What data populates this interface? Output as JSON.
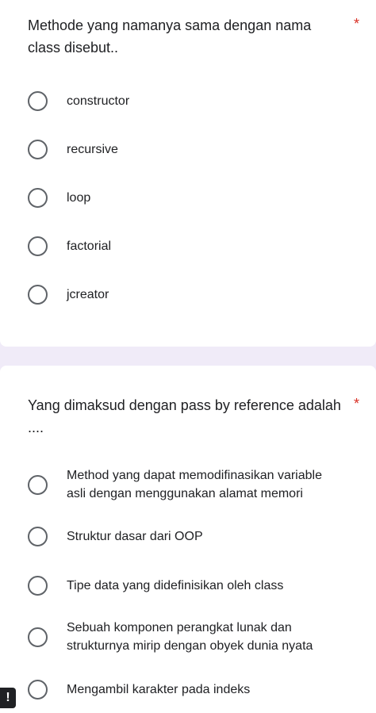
{
  "questions": [
    {
      "title": "Methode yang namanya sama dengan nama class disebut..",
      "required_mark": "*",
      "options": [
        "constructor",
        "recursive",
        "loop",
        "factorial",
        "jcreator"
      ]
    },
    {
      "title": "Yang dimaksud dengan pass by reference adalah ....",
      "required_mark": "*",
      "options": [
        "Method yang dapat memodifinasikan variable asli dengan menggunakan alamat memori",
        "Struktur dasar dari OOP",
        "Tipe data yang didefinisikan oleh class",
        "Sebuah komponen perangkat lunak dan strukturnya mirip dengan obyek dunia nyata",
        "Mengambil karakter pada indeks"
      ]
    }
  ],
  "warning_badge": "!",
  "colors": {
    "background": "#f0ebf8",
    "card": "#ffffff",
    "required": "#d93025",
    "radio_border": "#5f6368",
    "text": "#202124"
  },
  "icons": {
    "radio": "radio-unchecked-icon",
    "warning": "exclamation-icon"
  }
}
